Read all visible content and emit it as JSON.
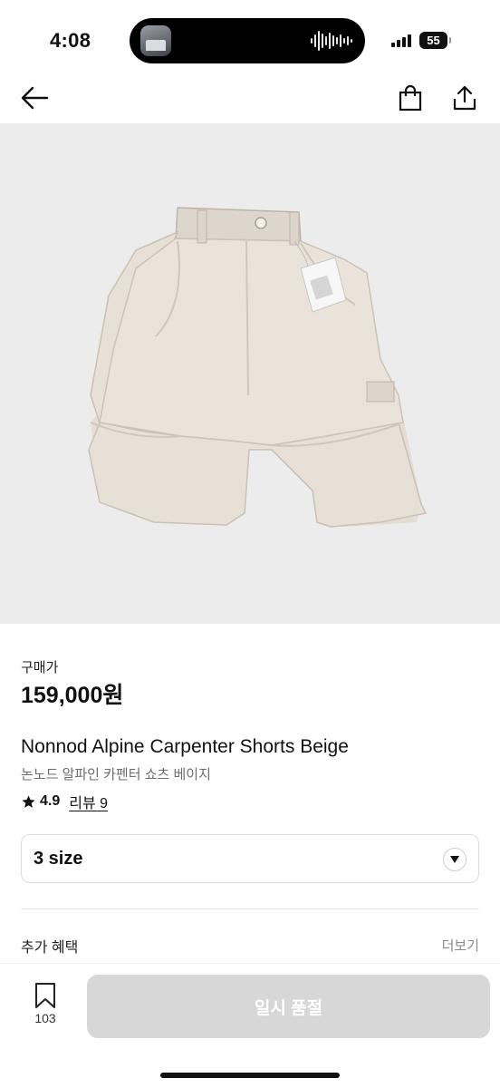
{
  "status_bar": {
    "time": "4:08",
    "battery": "55"
  },
  "nav": {
    "back_icon": "arrow-left-icon",
    "bag_icon": "shopping-bag-icon",
    "share_icon": "share-icon"
  },
  "product": {
    "image_alt": "beige carpenter shorts",
    "price_label": "구매가",
    "price": "159,000원",
    "name_en": "Nonnod Alpine Carpenter Shorts Beige",
    "name_ko": "논노드 알파인 카펜터 쇼츠 베이지",
    "rating": "4.9",
    "review_label": "리뷰 9"
  },
  "size_select": {
    "selected": "3 size"
  },
  "benefits": {
    "title": "추가 혜택",
    "more_label": "더보기"
  },
  "bottom_bar": {
    "wish_count": "103",
    "soldout_label": "일시 품절"
  },
  "colors": {
    "background": "#ffffff",
    "image_bg": "#ececec",
    "disabled_button": "#d7d7d7",
    "muted_text": "#8a8a8a"
  }
}
